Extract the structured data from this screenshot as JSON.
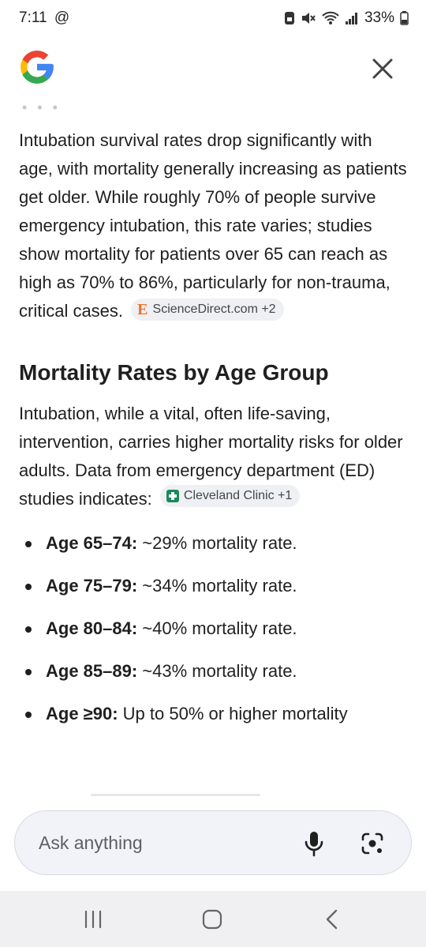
{
  "status_bar": {
    "time": "7:11",
    "at_icon": "@",
    "battery_percent": "33%",
    "icons": [
      "save-icon",
      "mute-icon",
      "wifi-icon",
      "signal-icon",
      "battery-icon"
    ]
  },
  "header": {
    "logo": "google-g-logo",
    "close_icon": "close-icon"
  },
  "content": {
    "intro_paragraph": "Intubation survival rates drop significantly with age, with mortality generally increasing as patients get older. While roughly 70% of people survive emergency intubation, this rate varies; studies show mortality for patients over 65 can reach as high as 70% to 86%, particularly for non-trauma, critical cases.",
    "intro_source_chip": {
      "icon_letter": "E",
      "label": "ScienceDirect.com +2"
    },
    "section_heading": "Mortality Rates by Age Group",
    "section_paragraph": "Intubation, while a vital, often life-saving, intervention, carries higher mortality risks for older adults. Data from emergency department (ED) studies indicates:",
    "section_source_chip": {
      "icon": "cleveland-clinic-icon",
      "label": "Cleveland Clinic +1"
    },
    "bullets": [
      {
        "label": "Age 65–74:",
        "text": " ~29% mortality rate."
      },
      {
        "label": "Age 75–79:",
        "text": " ~34% mortality rate."
      },
      {
        "label": "Age 80–84:",
        "text": " ~40% mortality rate."
      },
      {
        "label": "Age 85–89:",
        "text": " ~43% mortality rate."
      },
      {
        "label": "Age ≥90:",
        "text": " Up to 50% or higher mortality"
      }
    ]
  },
  "ask_bar": {
    "placeholder": "Ask anything",
    "mic_icon": "microphone-icon",
    "lens_icon": "lens-camera-icon"
  },
  "nav_bar": {
    "icons": [
      "recents-icon",
      "home-icon",
      "back-icon"
    ]
  },
  "colors": {
    "google_blue": "#4285F4",
    "google_red": "#EA4335",
    "google_yellow": "#FBBC05",
    "google_green": "#34A853",
    "sciencedirect_orange": "#e8742a",
    "cleveland_green": "#1a8a5a"
  }
}
